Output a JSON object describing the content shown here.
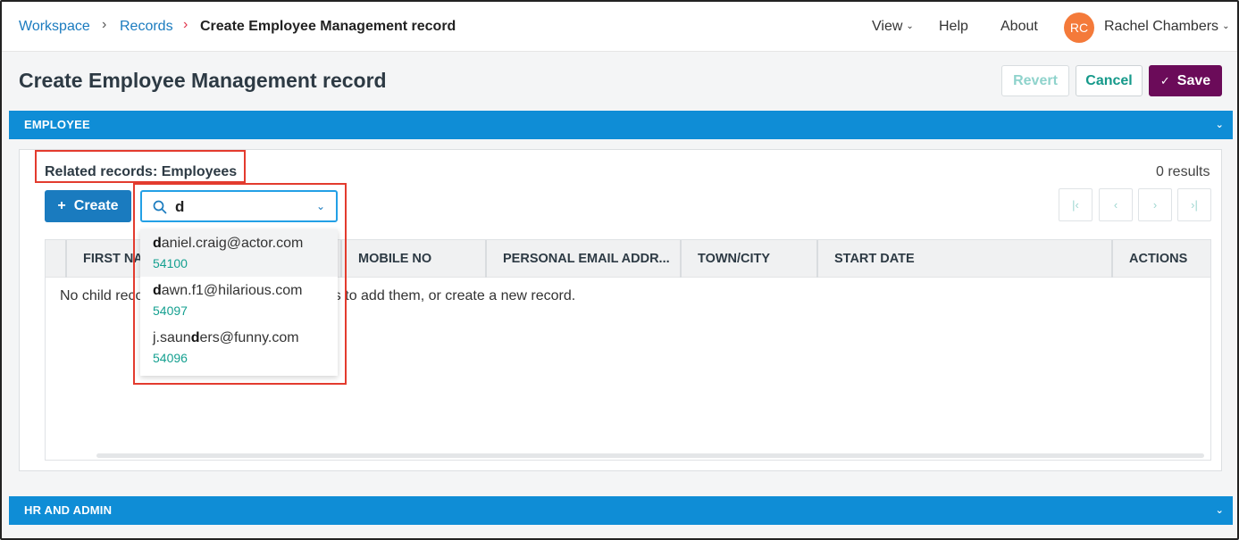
{
  "breadcrumb": {
    "items": [
      "Workspace",
      "Records"
    ],
    "current": "Create Employee Management record"
  },
  "nav": {
    "view": "View",
    "help": "Help",
    "about": "About",
    "user_initials": "RC",
    "user_name": "Rachel Chambers",
    "avatar_color": "#f47a3a"
  },
  "page": {
    "title": "Create Employee Management record",
    "revert": "Revert",
    "cancel": "Cancel",
    "save": "Save"
  },
  "sections": {
    "employee": "EMPLOYEE",
    "hr_admin": "HR AND ADMIN"
  },
  "related": {
    "title": "Related records: Employees",
    "results": "0 results",
    "create_label": "Create",
    "search_value": "d",
    "empty_message": "No child records. Search for existing records to add them, or create a new record."
  },
  "table": {
    "columns": [
      "FIRST NAME",
      "MOBILE NO",
      "PERSONAL EMAIL ADDR...",
      "TOWN/CITY",
      "START DATE",
      "ACTIONS"
    ]
  },
  "dropdown": {
    "options": [
      {
        "prefix": "",
        "bold": "d",
        "rest": "aniel.craig@actor.com",
        "id": "54100"
      },
      {
        "prefix": "",
        "bold": "d",
        "rest": "awn.f1@hilarious.com",
        "id": "54097"
      },
      {
        "prefix": "j.saun",
        "bold": "d",
        "rest": "ers@funny.com",
        "id": "54096"
      }
    ]
  },
  "colors": {
    "section_bar": "#0f8dd6",
    "link": "#1a7bbf",
    "save_button": "#6b0b59",
    "accent_teal": "#15998a",
    "highlight_border": "#e33b2e"
  }
}
